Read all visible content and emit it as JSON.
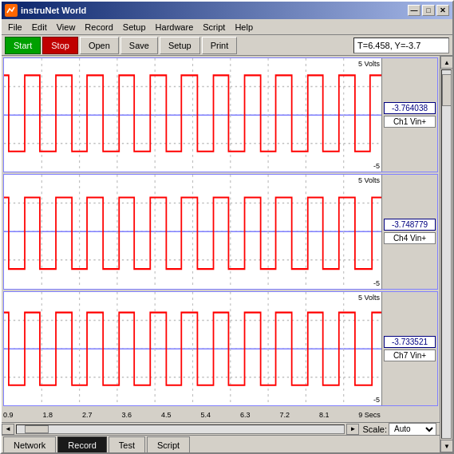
{
  "window": {
    "title": "instruNet World",
    "icon": "chart-icon"
  },
  "title_buttons": {
    "minimize": "—",
    "maximize": "□",
    "close": "✕"
  },
  "menu": {
    "items": [
      "File",
      "Edit",
      "View",
      "Record",
      "Setup",
      "Hardware",
      "Script",
      "Help"
    ]
  },
  "toolbar": {
    "start_label": "Start",
    "stop_label": "Stop",
    "open_label": "Open",
    "save_label": "Save",
    "setup_label": "Setup",
    "print_label": "Print",
    "status_text": "T=6.458,  Y=-3.7"
  },
  "charts": [
    {
      "top_label": "5 Volts",
      "bottom_label": "-5",
      "readout_value": "-3.764038",
      "readout_channel": "Ch1 Vin+"
    },
    {
      "top_label": "5 Volts",
      "bottom_label": "-5",
      "readout_value": "-3.748779",
      "readout_channel": "Ch4 Vin+"
    },
    {
      "top_label": "5 Volts",
      "bottom_label": "-5",
      "readout_value": "-3.733521",
      "readout_channel": "Ch7 Vin+"
    }
  ],
  "x_axis": {
    "labels": [
      "0.9",
      "1.8",
      "2.7",
      "3.6",
      "4.5",
      "5.4",
      "6.3",
      "7.2",
      "8.1",
      "9 Secs"
    ]
  },
  "scale": {
    "label": "Scale:",
    "value": "Auto"
  },
  "tabs": [
    {
      "label": "Network",
      "active": false
    },
    {
      "label": "Record",
      "active": true
    },
    {
      "label": "Test",
      "active": false
    },
    {
      "label": "Script",
      "active": false
    }
  ]
}
